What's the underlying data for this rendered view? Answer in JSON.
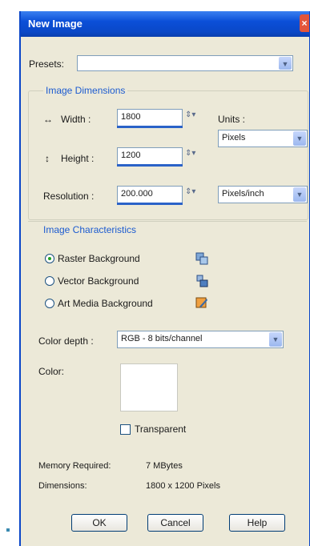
{
  "window": {
    "title": "New Image"
  },
  "presets": {
    "label": "Presets:",
    "value": ""
  },
  "image_dimensions": {
    "heading": "Image Dimensions",
    "width_label": "Width :",
    "width_value": "1800",
    "height_label": "Height :",
    "height_value": "1200",
    "resolution_label": "Resolution :",
    "resolution_value": "200.000",
    "units_label": "Units :",
    "units_value": "Pixels",
    "resolution_units_value": "Pixels/inch"
  },
  "image_characteristics": {
    "heading": "Image Characteristics",
    "options": [
      {
        "label": "Raster Background",
        "selected": true,
        "icon": "raster-layer-icon"
      },
      {
        "label": "Vector Background",
        "selected": false,
        "icon": "vector-layer-icon"
      },
      {
        "label": "Art Media Background",
        "selected": false,
        "icon": "art-media-icon"
      }
    ],
    "color_depth_label": "Color depth :",
    "color_depth_value": "RGB - 8 bits/channel",
    "color_label": "Color:",
    "color_swatch": "#ffffff",
    "transparent_label": "Transparent",
    "transparent_checked": false
  },
  "info": {
    "memory_label": "Memory Required:",
    "memory_value": "7 MBytes",
    "dimensions_label": "Dimensions:",
    "dimensions_value": "1800 x 1200 Pixels"
  },
  "buttons": {
    "ok": "OK",
    "cancel": "Cancel",
    "help": "Help"
  },
  "colors": {
    "titlebar": "#0a48c8",
    "dialog_bg": "#ece9d8",
    "heading": "#1c5bd0"
  }
}
